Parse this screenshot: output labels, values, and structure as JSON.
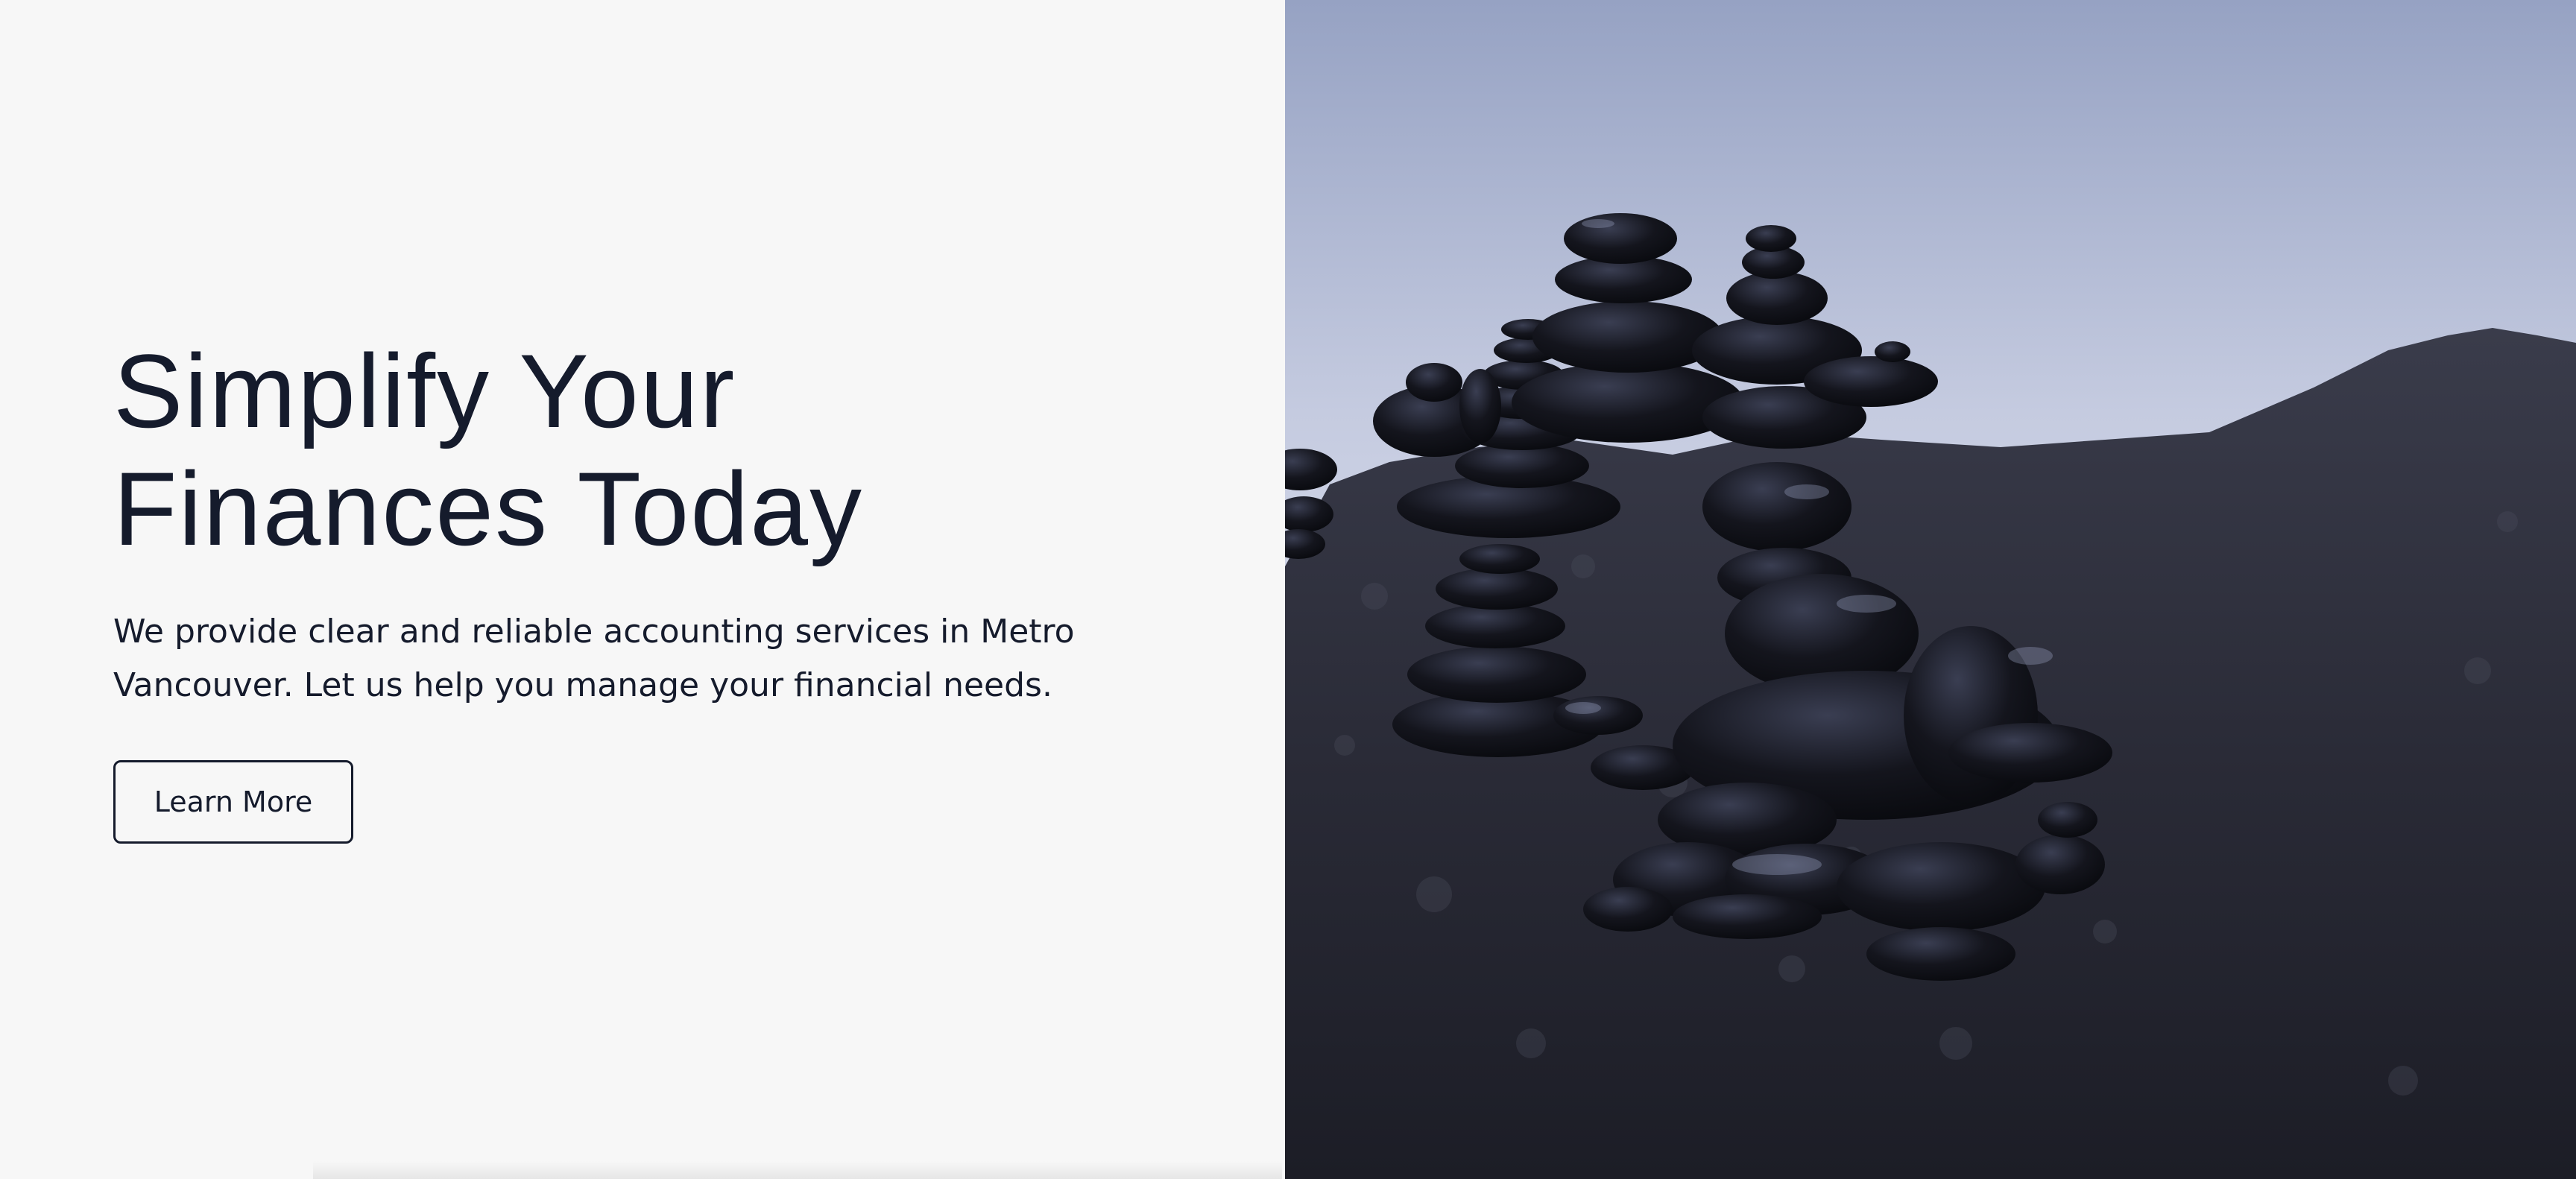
{
  "hero": {
    "title_line1": "Simplify Your",
    "title_line2": "Finances Today",
    "description_line1": "We provide clear and reliable accounting services in Metro",
    "description_line2": "Vancouver. Let us help you manage your financial needs.",
    "cta_label": "Learn More"
  },
  "image": {
    "subject": "stacked-stones-photo"
  },
  "colors": {
    "text": "#151b2c",
    "background": "#f7f7f7",
    "sky": "#b7c0d8",
    "rock": "#2b2c38"
  }
}
